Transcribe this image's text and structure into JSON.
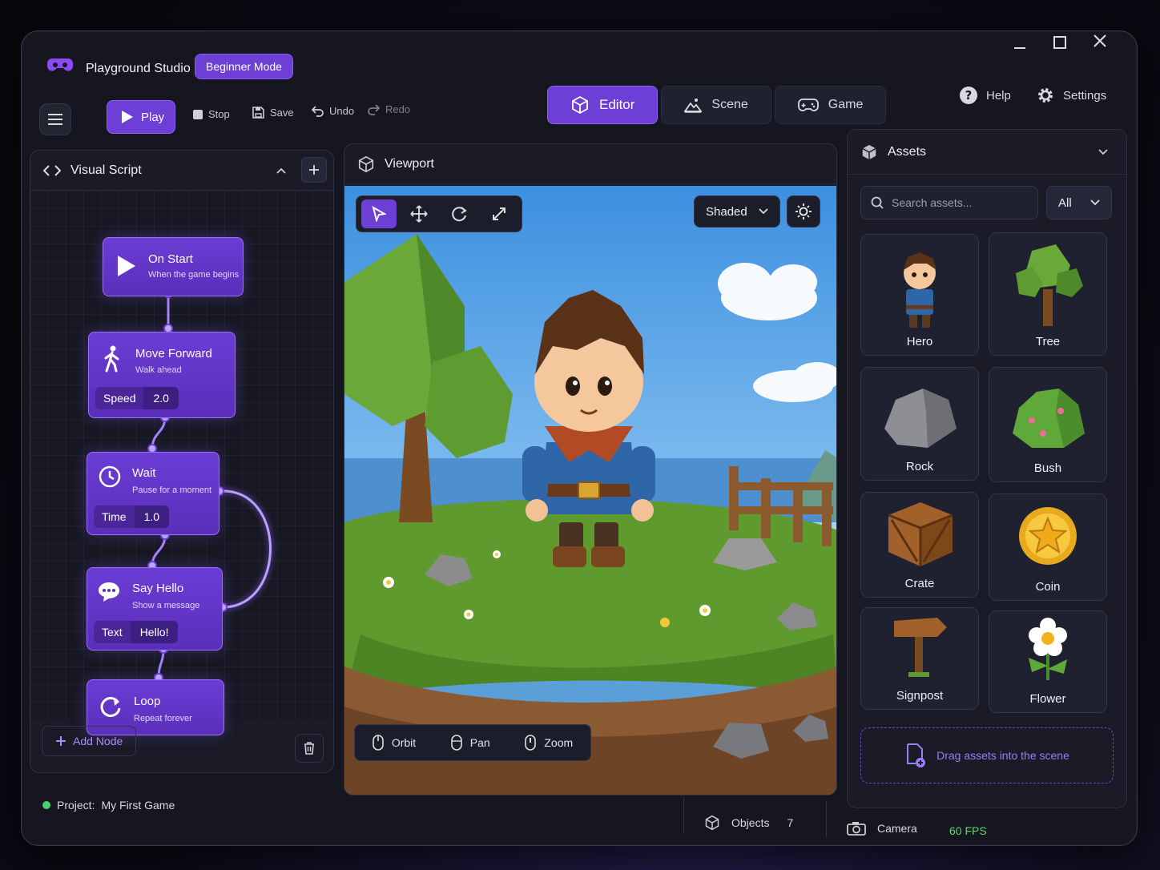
{
  "app": {
    "title": "Playground Studio",
    "mode_badge": "Beginner Mode"
  },
  "toolbar": {
    "play": "Play",
    "stop": "Stop",
    "save": "Save",
    "undo": "Undo",
    "redo": "Redo"
  },
  "tabs": [
    {
      "label": "Editor",
      "icon": "cube-icon",
      "active": true
    },
    {
      "label": "Scene",
      "icon": "landscape-icon",
      "active": false
    },
    {
      "label": "Game",
      "icon": "gamepad-icon",
      "active": false
    }
  ],
  "header_right": {
    "help": "Help",
    "settings": "Settings"
  },
  "visual_script": {
    "title": "Visual Script",
    "nodes": [
      {
        "title": "On Start",
        "subtitle": "When the game begins",
        "icon": "play-icon"
      },
      {
        "title": "Move Forward",
        "subtitle": "Walk ahead",
        "icon": "walk-icon",
        "param_label": "Speed",
        "param_value": "2.0"
      },
      {
        "title": "Wait",
        "subtitle": "Pause for a moment",
        "icon": "clock-icon",
        "param_label": "Time",
        "param_value": "1.0"
      },
      {
        "title": "Say Hello",
        "subtitle": "Show a message",
        "icon": "chat-icon",
        "param_label": "Text",
        "param_value": "Hello!"
      },
      {
        "title": "Loop",
        "subtitle": "Repeat forever",
        "icon": "loop-icon"
      }
    ],
    "add_node": "Add Node"
  },
  "viewport": {
    "title": "Viewport",
    "shading": "Shaded",
    "hints": [
      "Orbit",
      "Pan",
      "Zoom"
    ]
  },
  "assets": {
    "title": "Assets",
    "search_placeholder": "Search assets...",
    "filter": "All",
    "items": [
      "Hero",
      "Tree",
      "Rock",
      "Bush",
      "Crate",
      "Coin",
      "Signpost",
      "Flower"
    ],
    "drop_hint": "Drag assets into the scene"
  },
  "status": {
    "project_label": "Project:",
    "project_name": "My First Game",
    "objects_label": "Objects",
    "objects_count": "7",
    "camera_label": "Camera",
    "fps": "60 FPS"
  },
  "colors": {
    "accent": "#6d3fd6",
    "panel": "#1a1b26",
    "fps": "#5fd96a"
  }
}
